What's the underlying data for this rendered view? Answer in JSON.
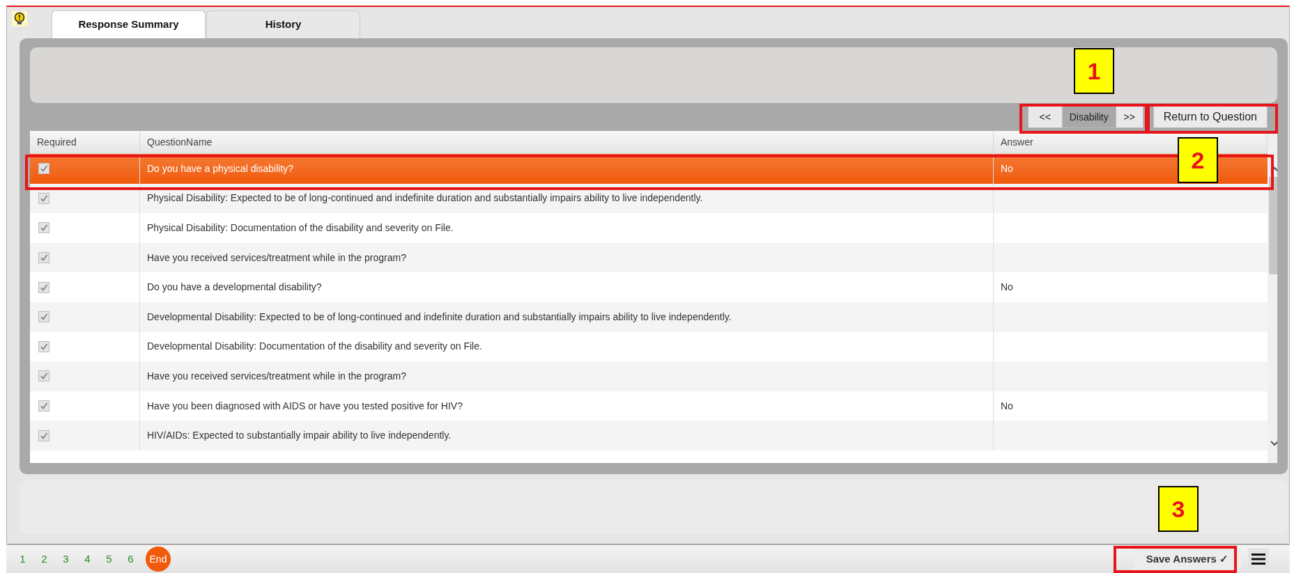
{
  "tabs": [
    {
      "label": "Response Summary",
      "selected": true
    },
    {
      "label": "History",
      "selected": false
    }
  ],
  "section_nav": {
    "prev": "<<",
    "current": "Disability",
    "next": ">>"
  },
  "return_button": "Return to Question",
  "table": {
    "columns": [
      "Required",
      "QuestionName",
      "Answer"
    ],
    "rows": [
      {
        "required": true,
        "question": "Do you have a physical disability?",
        "answer": "No",
        "selected": true
      },
      {
        "required": true,
        "question": "Physical Disability: Expected to be of long-continued and indefinite duration and substantially impairs ability to live independently.",
        "selected": false
      },
      {
        "required": true,
        "question": "Physical Disability: Documentation of the disability and severity on File.",
        "selected": false
      },
      {
        "required": true,
        "question": "Have you received services/treatment while in the program?",
        "selected": false
      },
      {
        "required": true,
        "question": "Do you have a developmental disability?",
        "answer": "No",
        "selected": false
      },
      {
        "required": true,
        "question": "Developmental Disability: Expected to be of long-continued and indefinite duration and substantially impairs ability to live independently.",
        "selected": false
      },
      {
        "required": true,
        "question": "Developmental Disability: Documentation of the disability and severity on File.",
        "selected": false
      },
      {
        "required": true,
        "question": "Have you received services/treatment while in the program?",
        "selected": false
      },
      {
        "required": true,
        "question": "Have you been diagnosed with AIDS or have you tested positive for HIV?",
        "answer": "No",
        "selected": false
      },
      {
        "required": true,
        "question": "HIV/AIDs: Expected to substantially impair ability to live independently.",
        "selected": false
      }
    ]
  },
  "pages": [
    {
      "label": "1",
      "selected": false
    },
    {
      "label": "2",
      "selected": false
    },
    {
      "label": "3",
      "selected": false
    },
    {
      "label": "4",
      "selected": false
    },
    {
      "label": "5",
      "selected": false
    },
    {
      "label": "6",
      "selected": false
    },
    {
      "label": "End",
      "selected": true
    }
  ],
  "save_button": "Save Answers ✓",
  "callouts": [
    "1",
    "2",
    "3"
  ]
}
